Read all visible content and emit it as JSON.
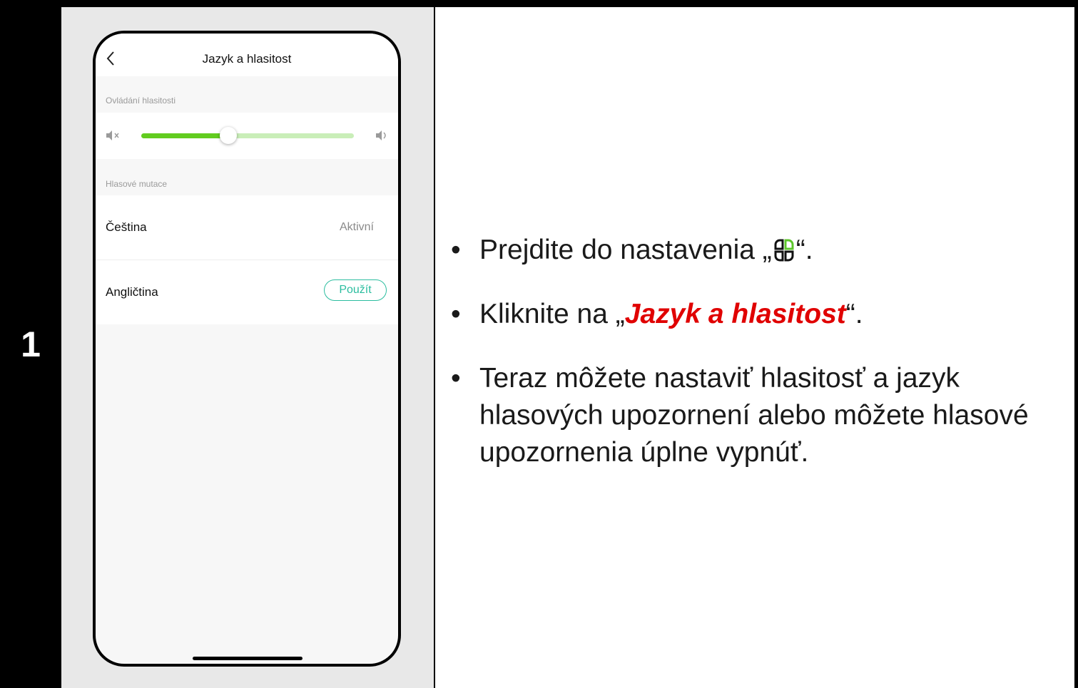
{
  "step": {
    "number": "1"
  },
  "phone": {
    "header": {
      "title": "Jazyk a hlasitost"
    },
    "volume": {
      "section_label": "Ovládání hlasitosti",
      "level": 0.41
    },
    "voices": {
      "section_label": "Hlasové mutace",
      "items": [
        {
          "name": "Čeština",
          "status": "Aktivní"
        },
        {
          "name": "Angličtina",
          "action": "Použít"
        }
      ]
    }
  },
  "instructions": {
    "step1": {
      "before": "Prejdite do nastavenia „",
      "after": "“.",
      "icon": "settings-grid-icon"
    },
    "step2": {
      "before": "Kliknite na „",
      "highlight": "Jazyk a hlasitost",
      "after": "“."
    },
    "step3": {
      "text": "Teraz môžete nastaviť hlasitosť a jazyk hlasových upozornení alebo môžete hlasové upozornenia úplne vypnúť."
    }
  },
  "colors": {
    "slider_active": "#62cc1f",
    "slider_inactive": "#c9eeb8",
    "button_accent": "#2bbd9f",
    "highlight": "#e00000"
  }
}
